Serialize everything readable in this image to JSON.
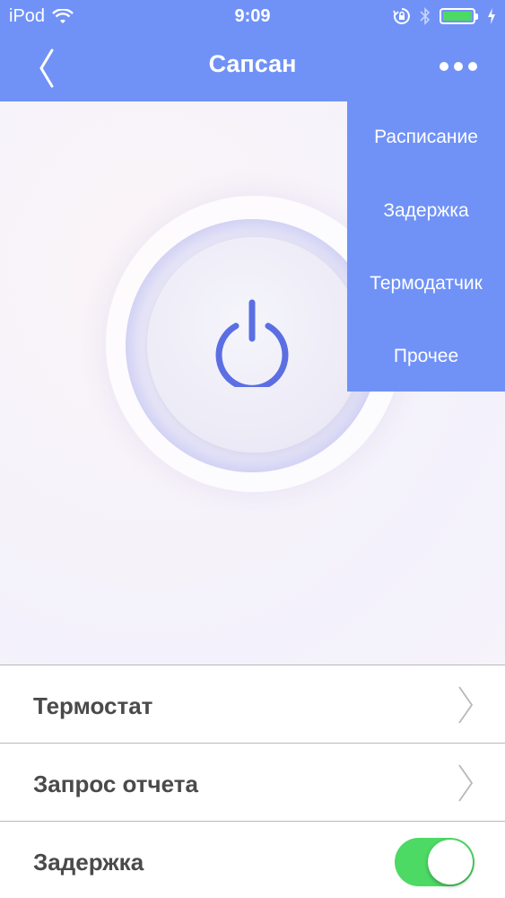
{
  "status_bar": {
    "carrier": "iPod",
    "time": "9:09",
    "icons": [
      "wifi-icon",
      "orientation-lock-icon",
      "bluetooth-icon",
      "battery-icon",
      "charging-icon"
    ]
  },
  "nav": {
    "title": "Сапсан",
    "back_icon": "chevron-left-icon",
    "more_icon": "more-dots-icon"
  },
  "main": {
    "power_button_icon": "power-icon"
  },
  "dropdown": {
    "items": [
      {
        "label": "Расписание"
      },
      {
        "label": "Задержка"
      },
      {
        "label": "Термодатчик"
      },
      {
        "label": "Прочее"
      }
    ]
  },
  "list": {
    "rows": [
      {
        "label": "Термостат",
        "accessory": "chevron-right-icon"
      },
      {
        "label": "Запрос отчета",
        "accessory": "chevron-right-icon"
      },
      {
        "label": "Задержка",
        "accessory": "toggle",
        "toggle_on": true
      }
    ]
  },
  "colors": {
    "accent": "#7092f7",
    "toggle_on": "#4cd964",
    "ring": "#7c84ec",
    "label_text": "#4a4a4a"
  }
}
